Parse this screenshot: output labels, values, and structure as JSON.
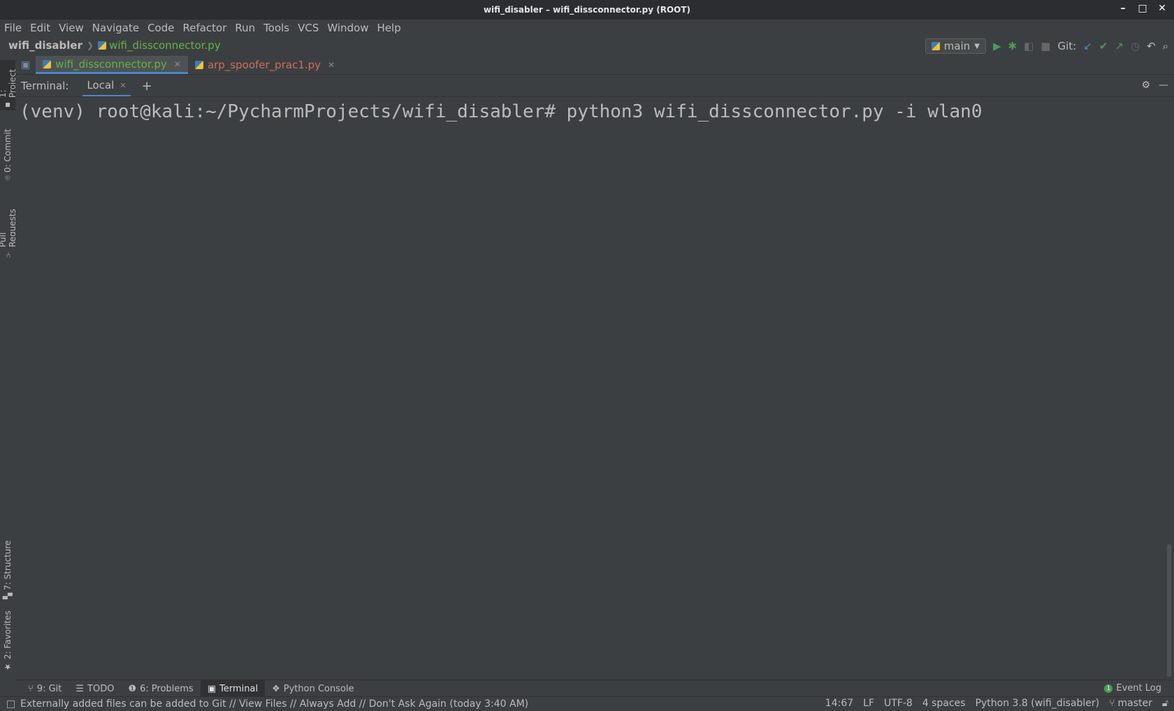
{
  "window": {
    "title": "wifi_disabler – wifi_dissconnector.py (ROOT)"
  },
  "menu": [
    "File",
    "Edit",
    "View",
    "Navigate",
    "Code",
    "Refactor",
    "Run",
    "Tools",
    "VCS",
    "Window",
    "Help"
  ],
  "breadcrumb": {
    "project": "wifi_disabler",
    "file": "wifi_dissconnector.py"
  },
  "toolbar": {
    "run_config": "main",
    "git_label": "Git:"
  },
  "editor_tabs": [
    {
      "label": "wifi_dissconnector.py",
      "color": "#62b543",
      "active": true
    },
    {
      "label": "arp_spoofer_prac1.py",
      "color": "#d26b5b",
      "active": false
    }
  ],
  "left_tool_tabs": {
    "project": "1: Project",
    "commit": "0: Commit",
    "pull_requests": "Pull Requests",
    "structure": "7: Structure",
    "favorites": "2: Favorites"
  },
  "terminal": {
    "label": "Terminal:",
    "tab": "Local",
    "line": "(venv) root@kali:~/PycharmProjects/wifi_disabler# python3 wifi_dissconnector.py -i wlan0"
  },
  "tool_windows": {
    "git": "9: Git",
    "todo": "TODO",
    "problems": "6: Problems",
    "terminal": "Terminal",
    "python_console": "Python Console",
    "event_log": "Event Log",
    "event_count": "1"
  },
  "status": {
    "message": "Externally added files can be added to Git // View Files // Always Add // Don't Ask Again (today 3:40 AM)",
    "position": "14:67",
    "line_sep": "LF",
    "encoding": "UTF-8",
    "indent": "4 spaces",
    "interpreter": "Python 3.8 (wifi_disabler)",
    "branch": "master"
  },
  "colors": {
    "accent": "#4a88c7",
    "run_green": "#499c54",
    "file_green": "#62b543",
    "file_red": "#d26b5b"
  }
}
